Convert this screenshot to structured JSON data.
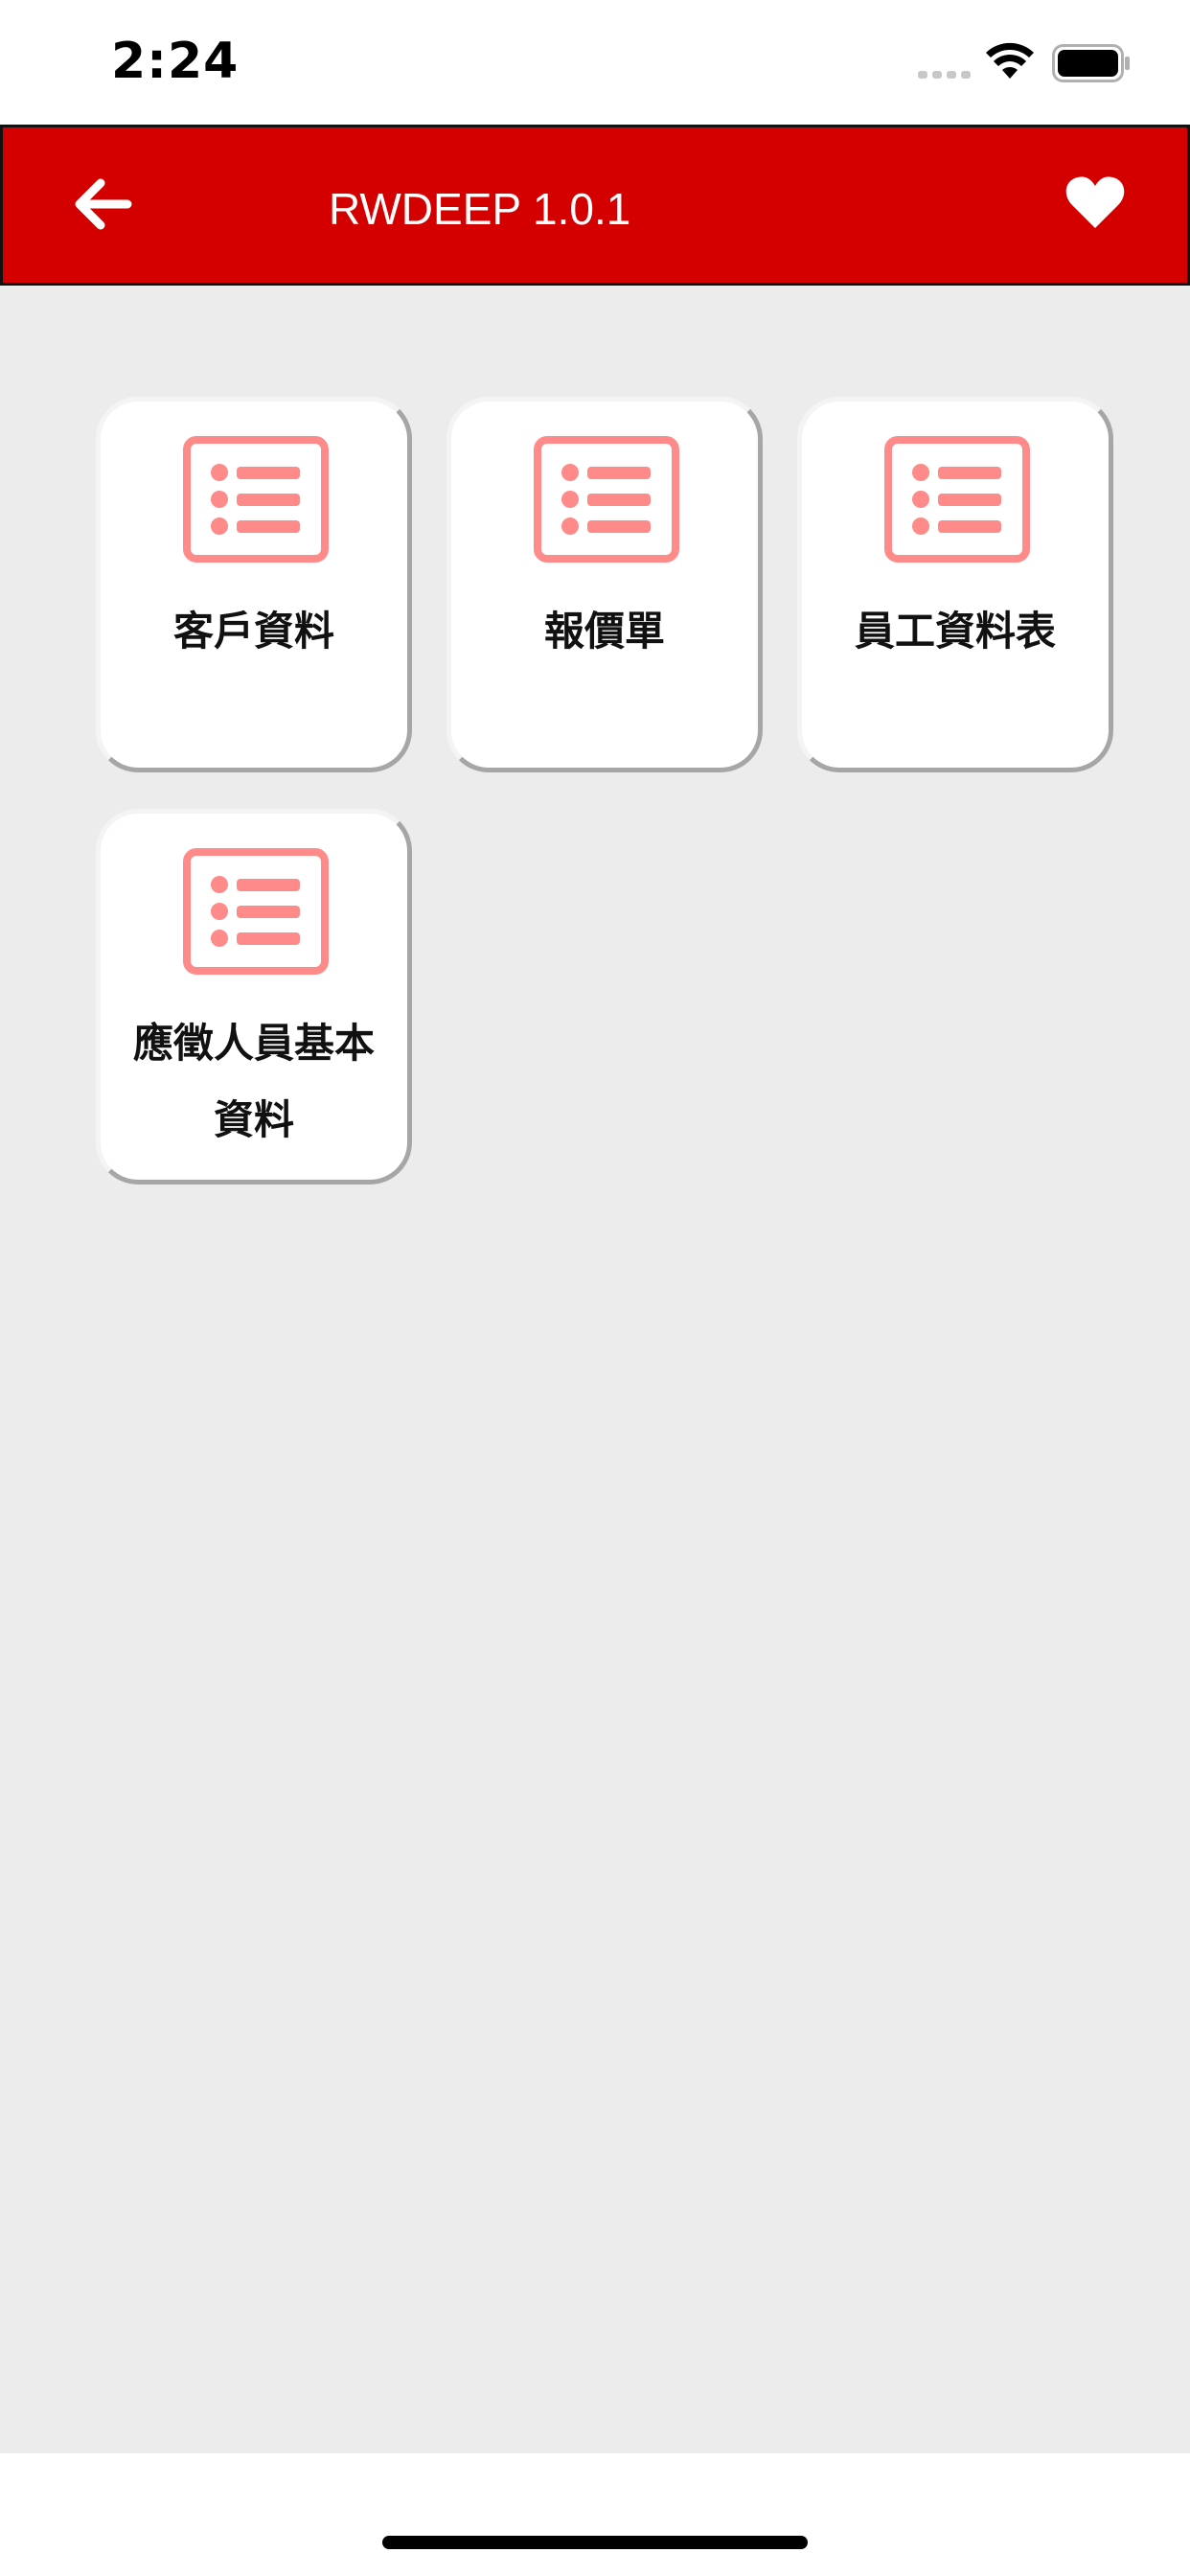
{
  "status_bar": {
    "time": "2:24"
  },
  "header": {
    "title": "RWDEEP 1.0.1",
    "back_icon": "arrow-left-icon",
    "favorite_icon": "heart-icon",
    "background_color": "#d40000"
  },
  "cards": [
    {
      "label": "客戶資料",
      "icon": "list-icon"
    },
    {
      "label": "報價單",
      "icon": "list-icon"
    },
    {
      "label": "員工資料表",
      "icon": "list-icon"
    },
    {
      "label": "應徵人員基本資料",
      "icon": "list-icon"
    }
  ],
  "colors": {
    "icon": "#fe8a8a",
    "page_background": "#ececec"
  }
}
